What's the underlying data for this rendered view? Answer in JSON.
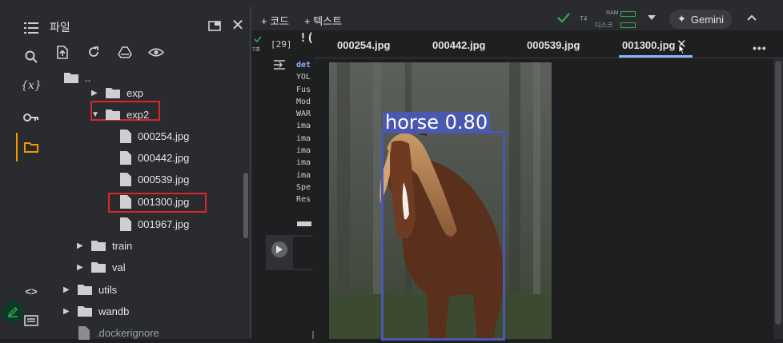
{
  "file_panel": {
    "title": "파일",
    "tree": [
      {
        "label": "..",
        "kind": "folder-up",
        "depth": 0
      },
      {
        "label": "exp",
        "kind": "folder",
        "depth": 2,
        "expanded": false
      },
      {
        "label": "exp2",
        "kind": "folder",
        "depth": 2,
        "expanded": true,
        "highlighted": true
      },
      {
        "label": "000254.jpg",
        "kind": "file",
        "depth": 3
      },
      {
        "label": "000442.jpg",
        "kind": "file",
        "depth": 3
      },
      {
        "label": "000539.jpg",
        "kind": "file",
        "depth": 3
      },
      {
        "label": "001300.jpg",
        "kind": "file",
        "depth": 3,
        "highlighted": true
      },
      {
        "label": "001967.jpg",
        "kind": "file",
        "depth": 3
      },
      {
        "label": "train",
        "kind": "folder",
        "depth": 1,
        "expanded": false
      },
      {
        "label": "val",
        "kind": "folder",
        "depth": 1,
        "expanded": false
      },
      {
        "label": "utils",
        "kind": "folder",
        "depth": 0,
        "expanded": false
      },
      {
        "label": "wandb",
        "kind": "folder",
        "depth": 0,
        "expanded": false
      },
      {
        "label": ".dockerignore",
        "kind": "file",
        "depth": 0
      }
    ]
  },
  "toolbar": {
    "add_code": "+ 코드",
    "add_text": "+ 텍스트",
    "runtime": "T4",
    "ram_label": "RAM",
    "disk_label": "디스크",
    "gemini": "Gemini"
  },
  "cell": {
    "exec_count": "[29]",
    "exec_time": "7초",
    "code_prefix": "!(",
    "output_lines": [
      "det",
      "YOL",
      "",
      "Fus",
      "Mod",
      "WAR",
      "ima",
      "ima",
      "ima",
      "ima",
      "ima",
      "Spe",
      "Res"
    ]
  },
  "tabs": [
    {
      "label": "000254.jpg",
      "active": false
    },
    {
      "label": "000442.jpg",
      "active": false
    },
    {
      "label": "000539.jpg",
      "active": false
    },
    {
      "label": "001300.jpg",
      "active": true
    }
  ],
  "viewer": {
    "detection_label": "horse 0.80"
  },
  "colors": {
    "accent": "#f29900",
    "highlight": "#d9262b",
    "detection_box": "#4a58b0",
    "tab_active": "#8ab4f8"
  },
  "icons": [
    "toc-icon",
    "search-icon",
    "variables-icon",
    "key-icon",
    "folder-icon",
    "code-icon",
    "terminal-icon",
    "upload-icon",
    "refresh-icon",
    "drive-icon",
    "eye-icon",
    "new-window-icon",
    "close-icon",
    "check-icon",
    "chevron-down-icon",
    "sparkle-icon",
    "chevron-up-icon",
    "more-icon",
    "play-icon",
    "edit-fab-icon"
  ]
}
